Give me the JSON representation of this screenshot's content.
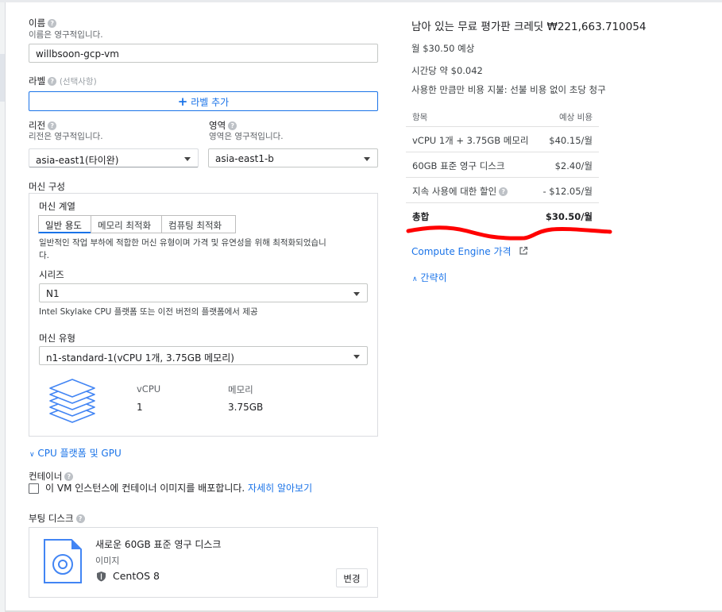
{
  "name": {
    "label": "이름",
    "hint": "이름은 영구적입니다.",
    "value": "willbsoon-gcp-vm"
  },
  "labels": {
    "label": "라벨",
    "optional": "(선택사항)",
    "add_button": "라벨 추가"
  },
  "region": {
    "label": "리전",
    "hint": "리전은 영구적입니다.",
    "value": "asia-east1(타이완)"
  },
  "zone": {
    "label": "영역",
    "hint": "영역은 영구적입니다.",
    "value": "asia-east1-b"
  },
  "machine_config": {
    "title": "머신 구성",
    "family_label": "머신 계열",
    "tabs": [
      "일반 용도",
      "메모리 최적화",
      "컴퓨팅 최적화"
    ],
    "family_description_line1": "일반적인 작업 부하에 적합한 머신 유형이며 가격 및 유연성을 위해 최적화되었습니",
    "family_description_line2": "다.",
    "series_label": "시리즈",
    "series_value": "N1",
    "series_description": "Intel Skylake CPU 플랫폼 또는 이전 버전의 플랫폼에서 제공",
    "machine_type_label": "머신 유형",
    "machine_type_value": "n1-standard-1(vCPU 1개, 3.75GB 메모리)",
    "vcpu_header": "vCPU",
    "memory_header": "메모리",
    "vcpu_value": "1",
    "memory_value": "3.75GB"
  },
  "cpu_gpu_link": "CPU 플랫폼 및 GPU",
  "container": {
    "label": "컨테이너",
    "checkbox_text": "이 VM 인스턴스에 컨테이너 이미지를 배포합니다.",
    "learn_more": "자세히 알아보기"
  },
  "boot_disk": {
    "label": "부팅 디스크",
    "title": "새로운 60GB 표준 영구 디스크",
    "image_label": "이미지",
    "os": "CentOS 8",
    "change_button": "변경"
  },
  "cost": {
    "credit": "남아 있는 무료 평가판 크레딧 ₩221,663.710054",
    "monthly": "월 $30.50 예상",
    "hourly": "시간당 약 $0.042",
    "billing_note": "사용한 만큼만 비용 지불: 선불 비용 없이 초당 청구",
    "col_item": "항목",
    "col_cost": "예상 비용",
    "rows": [
      {
        "name": "vCPU 1개 + 3.75GB 메모리",
        "value": "$40.15/월"
      },
      {
        "name": "60GB 표준 영구 디스크",
        "value": "$2.40/월"
      },
      {
        "name": "지속 사용에 대한 할인",
        "value": "- $12.05/월"
      }
    ],
    "total_label": "총합",
    "total_value": "$30.50/월",
    "pricing_link": "Compute Engine 가격",
    "collapse_link": "간략히"
  },
  "colors": {
    "accent": "#1a73e8",
    "annotation": "#ff0000"
  }
}
